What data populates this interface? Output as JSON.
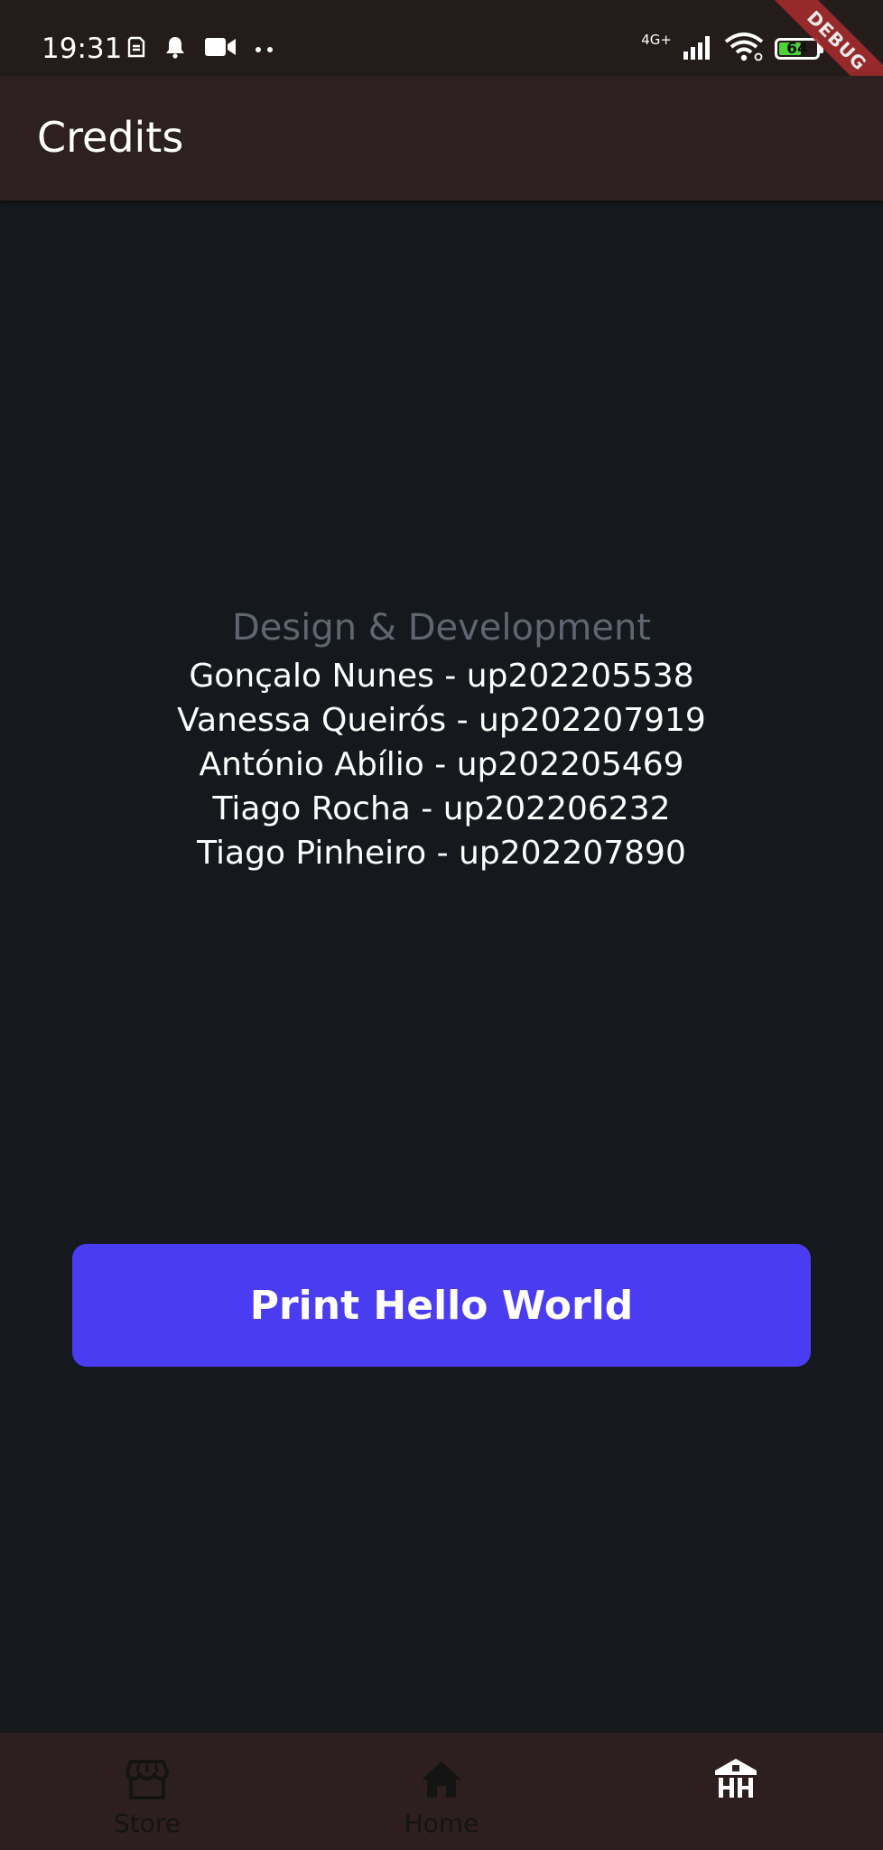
{
  "status_bar": {
    "time": "19:31",
    "network": "4G+",
    "battery": "64",
    "battery_level": 0.64,
    "icons_left": [
      "sim-icon",
      "notification-bell-icon",
      "video-camera-icon",
      "more-dots-icon"
    ],
    "icons_right": [
      "signal-icon",
      "wifi-icon",
      "battery-icon"
    ]
  },
  "debug_banner": "DEBUG",
  "app_bar": {
    "title": "Credits"
  },
  "credits": {
    "heading": "Design & Development",
    "people": [
      "Gonçalo Nunes - up202205538",
      "Vanessa Queirós - up202207919",
      "António Abílio - up202205469",
      "Tiago Rocha - up202206232",
      "Tiago Pinheiro - up202207890"
    ]
  },
  "action_button": {
    "label": "Print Hello World",
    "color": "#4a3cf0"
  },
  "bottom_nav": {
    "items": [
      {
        "label": "Store",
        "icon": "store-icon"
      },
      {
        "label": "Home",
        "icon": "home-icon"
      },
      {
        "label": "",
        "icon": "university-icon",
        "selected": true
      }
    ]
  },
  "colors": {
    "background": "#15181c",
    "app_bar": "#2d2020",
    "status_bar": "#241b1b",
    "heading_text": "#5f6670"
  }
}
